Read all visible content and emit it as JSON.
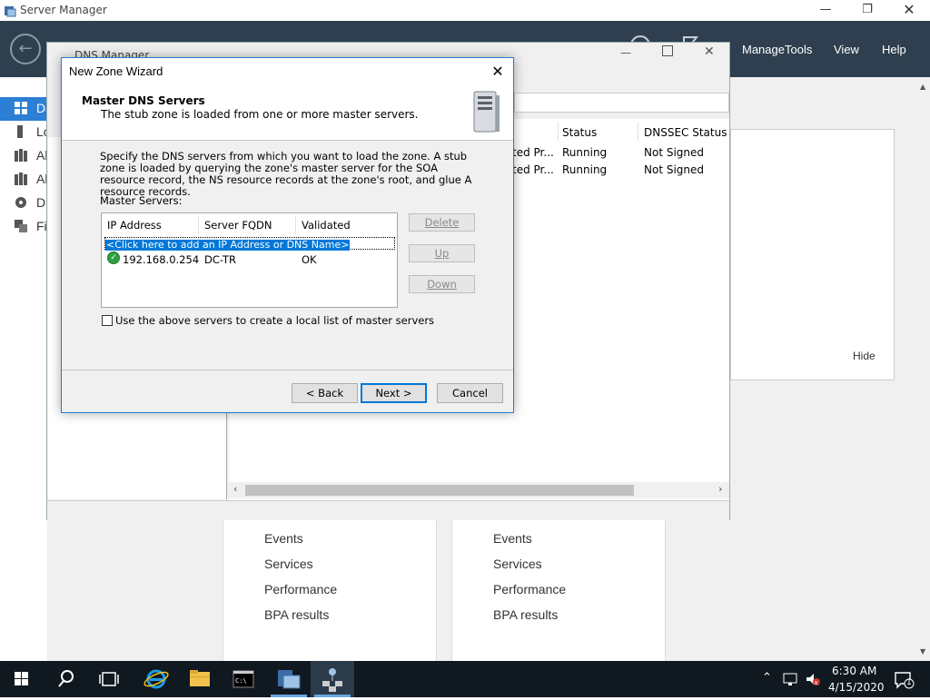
{
  "server_manager": {
    "title": "Server Manager",
    "menu": {
      "manage": "Manage",
      "tools": "Tools",
      "view": "View",
      "help": "Help"
    },
    "nav_items": [
      "Da",
      "Lo",
      "Al",
      "Al",
      "D",
      "Fi"
    ],
    "tiles": [
      {
        "items": [
          "Events",
          "Services",
          "Performance",
          "BPA results"
        ]
      },
      {
        "items": [
          "Events",
          "Services",
          "Performance",
          "BPA results"
        ]
      }
    ],
    "hide_label": "Hide"
  },
  "dns_manager": {
    "title": "DNS Manager",
    "columns": {
      "status": "Status",
      "dnssec": "DNSSEC Status"
    },
    "rows": [
      {
        "type": "ted Pr...",
        "status": "Running",
        "dnssec": "Not Signed"
      },
      {
        "type": "ted Pr...",
        "status": "Running",
        "dnssec": "Not Signed"
      }
    ]
  },
  "wizard": {
    "title": "New Zone Wizard",
    "heading": "Master DNS Servers",
    "subheading": "The stub zone is loaded from one or more master servers.",
    "description": "Specify the DNS servers from which you want to load the zone. A stub zone is loaded by querying the zone's master server for the SOA resource record, the NS resource records at the zone's root, and glue A resource records.",
    "master_servers_label": "Master Servers:",
    "columns": {
      "ip": "IP Address",
      "fqdn": "Server FQDN",
      "validated": "Validated"
    },
    "add_prompt": "<Click here to add an IP Address or DNS Name>",
    "servers": [
      {
        "ip": "192.168.0.254",
        "fqdn": "DC-TR",
        "validated": "OK"
      }
    ],
    "buttons": {
      "delete": "Delete",
      "up": "Up",
      "down": "Down",
      "back": "< Back",
      "next": "Next >",
      "cancel": "Cancel"
    },
    "checkbox_label": "Use the above servers to create a local list of master servers"
  },
  "taskbar": {
    "time": "6:30 AM",
    "date": "4/15/2020",
    "notification_count": "1"
  },
  "colors": {
    "header_bg": "#2f3f4f",
    "accent": "#2b7fd4",
    "taskbar_bg": "#101820",
    "selection": "#0078d7"
  }
}
